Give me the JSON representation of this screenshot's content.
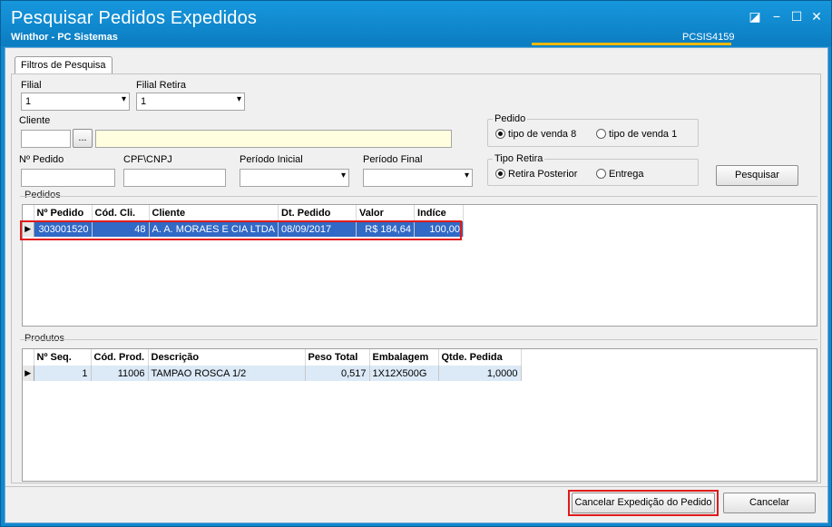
{
  "window": {
    "title": "Pesquisar Pedidos Expedidos",
    "subtitle": "Winthor - PC Sistemas",
    "code": "PCSIS4159",
    "btn_resize": "◪",
    "btn_min": "−",
    "btn_max": "☐",
    "btn_close": "✕"
  },
  "tabs": {
    "filtros": "Filtros de Pesquisa"
  },
  "filters": {
    "filial_label": "Filial",
    "filial_value": "1",
    "filial_retira_label": "Filial Retira",
    "filial_retira_value": "1",
    "cliente_label": "Cliente",
    "cliente_code": "",
    "cliente_lookup": "...",
    "cliente_name": "",
    "npedido_label": "Nº Pedido",
    "npedido_value": "",
    "cpf_label": "CPF\\CNPJ",
    "cpf_value": "",
    "periodo_inicial_label": "Período Inicial",
    "periodo_inicial_value": "",
    "periodo_final_label": "Período Final",
    "periodo_final_value": "",
    "pedido_group": "Pedido",
    "pedido_opt1": "tipo de venda 8",
    "pedido_opt2": "tipo de venda 1",
    "tipo_retira_group": "Tipo Retira",
    "retira_opt1": "Retira Posterior",
    "retira_opt2": "Entrega",
    "pesquisar_label": "Pesquisar"
  },
  "pedidos": {
    "title": "Pedidos",
    "columns": [
      "Nº Pedido",
      "Cód. Cli.",
      "Cliente",
      "Dt. Pedido",
      "Valor",
      "Indíce"
    ],
    "rows": [
      [
        "303001520",
        "48",
        "A. A. MORAES E CIA LTDA",
        "08/09/2017",
        "R$ 184,64",
        "100,00"
      ]
    ]
  },
  "produtos": {
    "title": "Produtos",
    "columns": [
      "Nº Seq.",
      "Cód. Prod.",
      "Descrição",
      "Peso Total",
      "Embalagem",
      "Qtde. Pedida"
    ],
    "rows": [
      [
        "1",
        "11006",
        "TAMPAO ROSCA 1/2",
        "0,517",
        "1X12X500G",
        "1,0000"
      ]
    ]
  },
  "footer": {
    "cancelar_expedicao": "Cancelar Expedição do Pedido",
    "cancelar": "Cancelar"
  },
  "icons": {
    "dropdown": "chevron-down-icon",
    "row_pointer": "row-pointer-icon"
  },
  "colors": {
    "titlebar": "#0b7cc1",
    "selection": "#3169c6",
    "highlight_box": "#e01a1a",
    "code_underline": "#f5b800"
  }
}
